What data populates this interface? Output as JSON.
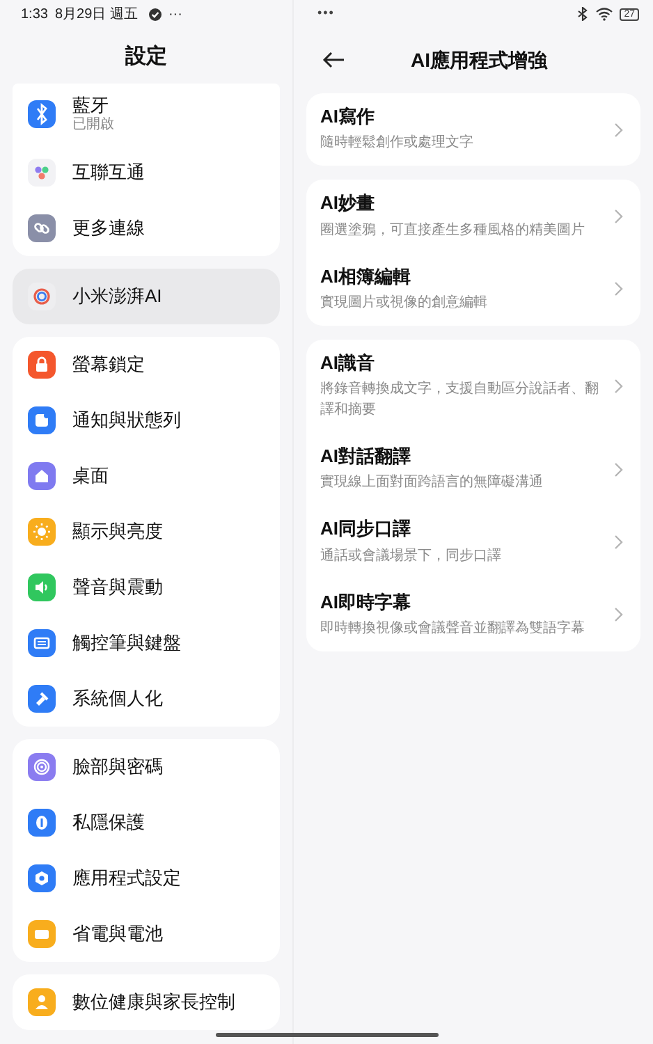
{
  "status_bar": {
    "time": "1:33",
    "date": "8月29日 週五",
    "more_left": "···",
    "more_center": "•••",
    "battery": "27"
  },
  "sidebar": {
    "title": "設定",
    "groups": [
      {
        "items": [
          {
            "label": "藍牙",
            "sublabel": "已開啟",
            "color": "#2f7cf6",
            "selected": false
          },
          {
            "label": "互聯互通",
            "color": "#f2f2f5",
            "selected": false
          },
          {
            "label": "更多連線",
            "color": "#8a8fa8",
            "selected": false
          }
        ]
      },
      {
        "items": [
          {
            "label": "小米澎湃AI",
            "color": "#eeeef0",
            "selected": true
          }
        ]
      },
      {
        "items": [
          {
            "label": "螢幕鎖定",
            "color": "#f4572d",
            "selected": false
          },
          {
            "label": "通知與狀態列",
            "color": "#2f7cf6",
            "selected": false
          },
          {
            "label": "桌面",
            "color": "#7f7af0",
            "selected": false
          },
          {
            "label": "顯示與亮度",
            "color": "#f8ad1d",
            "selected": false
          },
          {
            "label": "聲音與震動",
            "color": "#30c75e",
            "selected": false
          },
          {
            "label": "觸控筆與鍵盤",
            "color": "#2f7cf6",
            "selected": false
          },
          {
            "label": "系統個人化",
            "color": "#2f7cf6",
            "selected": false
          }
        ]
      },
      {
        "items": [
          {
            "label": "臉部與密碼",
            "color": "#8a7cf0",
            "selected": false
          },
          {
            "label": "私隱保護",
            "color": "#2f7cf6",
            "selected": false
          },
          {
            "label": "應用程式設定",
            "color": "#2f7cf6",
            "selected": false
          },
          {
            "label": "省電與電池",
            "color": "#f8ad1d",
            "selected": false
          }
        ]
      },
      {
        "items": [
          {
            "label": "數位健康與家長控制",
            "color": "#f8ad1d",
            "selected": false
          }
        ]
      }
    ]
  },
  "detail": {
    "title": "AI應用程式增強",
    "groups": [
      {
        "items": [
          {
            "title": "AI寫作",
            "subtitle": "隨時輕鬆創作或處理文字"
          }
        ]
      },
      {
        "items": [
          {
            "title": "AI妙畫",
            "subtitle": "圈選塗鴉，可直接產生多種風格的精美圖片"
          },
          {
            "title": "AI相簿編輯",
            "subtitle": "實現圖片或視像的創意編輯"
          }
        ]
      },
      {
        "items": [
          {
            "title": "AI識音",
            "subtitle": "將錄音轉換成文字，支援自動區分說話者、翻譯和摘要"
          },
          {
            "title": "AI對話翻譯",
            "subtitle": "實現線上面對面跨語言的無障礙溝通"
          },
          {
            "title": "AI同步口譯",
            "subtitle": "通話或會議場景下，同步口譯"
          },
          {
            "title": "AI即時字幕",
            "subtitle": "即時轉換視像或會議聲音並翻譯為雙語字幕"
          }
        ]
      }
    ]
  }
}
